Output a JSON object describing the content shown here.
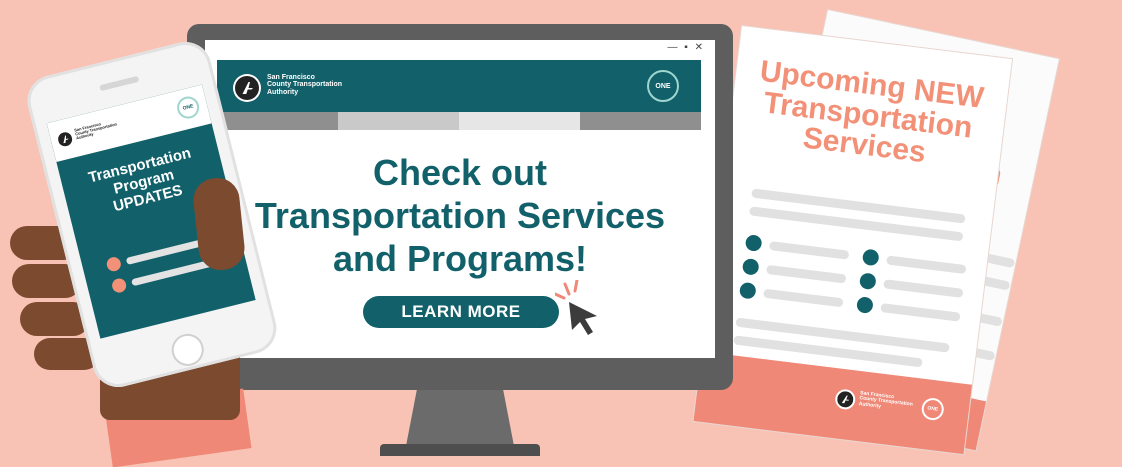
{
  "monitor": {
    "window_controls": "— ▪ ✕",
    "org_name": [
      "San Francisco",
      "County Transportation",
      "Authority"
    ],
    "badge_text": "ONE",
    "headline_lines": [
      "Check out",
      "Transportation Services",
      "and Programs!"
    ],
    "cta_label": "LEARN MORE",
    "nav_colors": [
      "#8f8f8f",
      "#c9c9c9",
      "#e6e6e6",
      "#8f8f8f"
    ]
  },
  "phone": {
    "org_name": [
      "San Francisco",
      "County Transportation",
      "Authority"
    ],
    "badge_text": "ONE",
    "title_lines": [
      "Transportation",
      "Program",
      "UPDATES"
    ]
  },
  "flyer": {
    "title_lines": [
      "Upcoming NEW",
      "Transportation",
      "Services"
    ],
    "back_fragment": "on",
    "org_name": [
      "San Francisco",
      "County Transportation",
      "Authority"
    ],
    "badge_text": "ONE"
  },
  "colors": {
    "background": "#f8c3b4",
    "brand_teal": "#12616a",
    "accent_coral": "#ef8876",
    "skin": "#7c4a2e"
  },
  "icons": [
    "cursor-pointer-icon",
    "sfcta-logo-icon",
    "one-badge-icon"
  ]
}
